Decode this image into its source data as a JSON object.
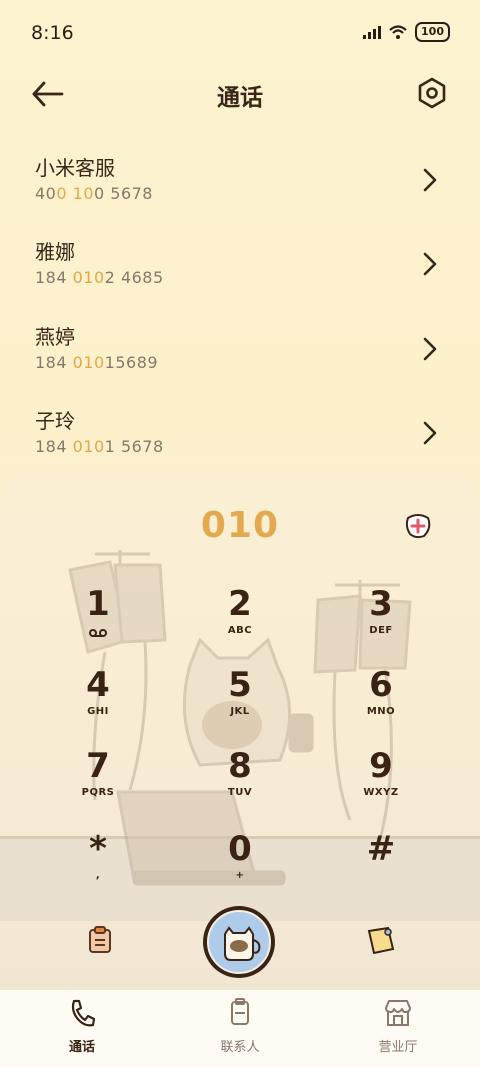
{
  "status": {
    "time": "8:16",
    "battery": "100"
  },
  "header": {
    "title": "通话"
  },
  "contacts": [
    {
      "name": "小米客服",
      "num_pre": "40",
      "num_hl1": "0",
      "num_mid": " ",
      "num_hl2": "10",
      "num_post": "0 5678"
    },
    {
      "name": "雅娜",
      "num_pre": "184 ",
      "num_hl1": "010",
      "num_mid": "",
      "num_hl2": "",
      "num_post": "2 4685"
    },
    {
      "name": "燕婷",
      "num_pre": "184 ",
      "num_hl1": "010",
      "num_mid": "",
      "num_hl2": "",
      "num_post": "15689"
    },
    {
      "name": "子玲",
      "num_pre": "184 ",
      "num_hl1": "010",
      "num_mid": "",
      "num_hl2": "",
      "num_post": "1 5678"
    }
  ],
  "dialer": {
    "input": "010",
    "keys": [
      {
        "digit": "1",
        "letters": ""
      },
      {
        "digit": "2",
        "letters": "ABC"
      },
      {
        "digit": "3",
        "letters": "DEF"
      },
      {
        "digit": "4",
        "letters": "GHI"
      },
      {
        "digit": "5",
        "letters": "JKL"
      },
      {
        "digit": "6",
        "letters": "MNO"
      },
      {
        "digit": "7",
        "letters": "PQRS"
      },
      {
        "digit": "8",
        "letters": "TUV"
      },
      {
        "digit": "9",
        "letters": "WXYZ"
      },
      {
        "digit": "*",
        "letters": ","
      },
      {
        "digit": "0",
        "letters": "+"
      },
      {
        "digit": "#",
        "letters": ""
      }
    ]
  },
  "nav": [
    {
      "label": "通话",
      "active": true
    },
    {
      "label": "联系人",
      "active": false
    },
    {
      "label": "营业厅",
      "active": false
    }
  ],
  "colors": {
    "accent": "#e2a94e",
    "dark": "#3a2314",
    "call_button": "#aecbe9"
  }
}
